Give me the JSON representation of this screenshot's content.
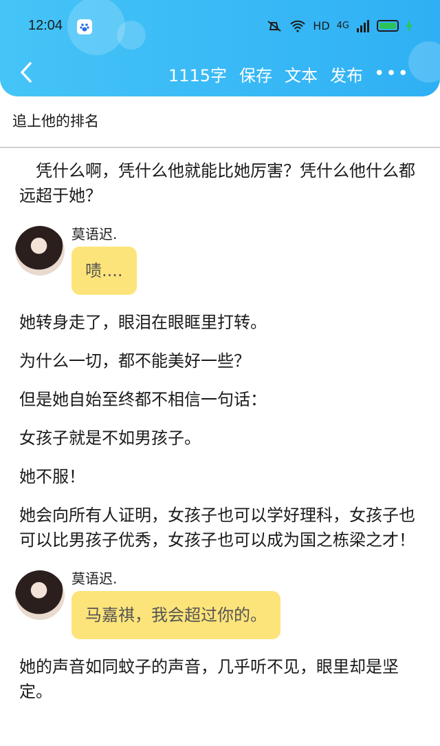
{
  "status": {
    "time": "12:04",
    "hd": "HD",
    "network": "4G"
  },
  "nav": {
    "word_count": "1115字",
    "save": "保存",
    "text": "文本",
    "publish": "发布",
    "more": "•••"
  },
  "chapter_title": "追上他的排名",
  "content": {
    "p1": "　凭什么啊，凭什么他就能比她厉害？凭什么他什么都远超于她？",
    "chat1": {
      "name": "莫语迟.",
      "message": "啧...."
    },
    "p2": "她转身走了，眼泪在眼眶里打转。",
    "p3": "为什么一切，都不能美好一些？",
    "p4": " 但是她自始至终都不相信一句话：",
    "p5": "女孩子就是不如男孩子。",
    "p6": " 她不服！",
    "p7": " 她会向所有人证明，女孩子也可以学好理科，女孩子也可以比男孩子优秀，女孩子也可以成为国之栋梁之才！",
    "chat2": {
      "name": "莫语迟.",
      "message": "马嘉祺，我会超过你的。"
    },
    "p8": "她的声音如同蚊子的声音，几乎听不见，眼里却是坚定。"
  }
}
